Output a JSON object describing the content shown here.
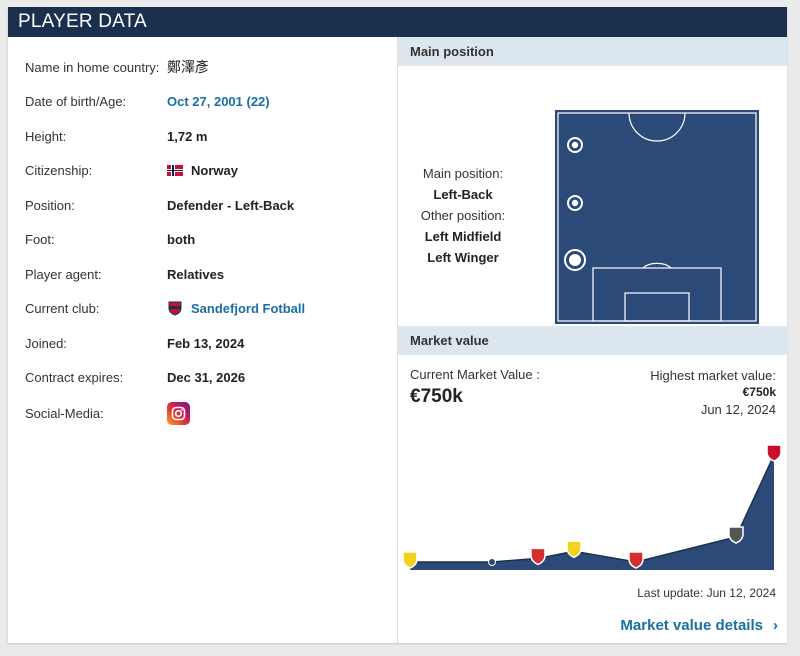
{
  "header": {
    "title": "PLAYER DATA"
  },
  "player_info": [
    {
      "label": "Name in home country:",
      "value": "鄭澤彥",
      "style": "plain"
    },
    {
      "label": "Date of birth/Age:",
      "value": "Oct 27, 2001 (22)",
      "style": "link"
    },
    {
      "label": "Height:",
      "value": "1,72 m",
      "style": "bold"
    },
    {
      "label": "Citizenship:",
      "value": "Norway",
      "style": "bold",
      "icon": "norway-flag-icon"
    },
    {
      "label": "Position:",
      "value": "Defender - Left-Back",
      "style": "bold"
    },
    {
      "label": "Foot:",
      "value": "both",
      "style": "bold"
    },
    {
      "label": "Player agent:",
      "value": "Relatives",
      "style": "bold"
    },
    {
      "label": "Current club:",
      "value": "Sandefjord Fotball",
      "style": "link",
      "icon": "club-crest-icon"
    },
    {
      "label": "Joined:",
      "value": "Feb 13, 2024",
      "style": "bold"
    },
    {
      "label": "Contract expires:",
      "value": "Dec 31, 2026",
      "style": "bold"
    },
    {
      "label": "Social-Media:",
      "value": "",
      "style": "bold",
      "icon": "instagram-icon"
    }
  ],
  "main_position": {
    "header": "Main position",
    "main_label": "Main position:",
    "main_value": "Left-Back",
    "other_label": "Other position:",
    "other_values": [
      "Left Midfield",
      "Left Winger"
    ]
  },
  "market_value": {
    "header": "Market value",
    "current_label": "Current Market Value :",
    "current_value": "€750k",
    "highest_label": "Highest market value:",
    "highest_value": "€750k",
    "highest_date": "Jun 12, 2024",
    "last_update": "Last update: Jun 12, 2024",
    "details_link": "Market value details",
    "chevron_icon": "chevron-right-icon"
  },
  "colors": {
    "header_bg": "#1b2f4e",
    "accent_link": "#1a6fa3",
    "pitch": "#2b4a78",
    "chart_fill": "#2b4a78",
    "section_bg": "#dbe6ee"
  },
  "chart_data": {
    "type": "area",
    "x": [
      1,
      2,
      3,
      4,
      5,
      6,
      7
    ],
    "values": [
      0,
      0,
      25,
      75,
      0,
      175,
      750
    ],
    "ylim": [
      0,
      750
    ]
  }
}
